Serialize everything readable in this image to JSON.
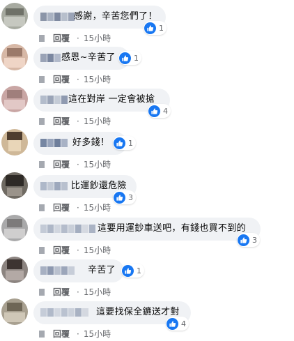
{
  "actions": {
    "reply": "回覆",
    "dot": "·",
    "time": "15小時"
  },
  "comments": [
    {
      "text": "感謝，辛苦您們了！",
      "likes": "1"
    },
    {
      "text": "感恩~辛苦了",
      "likes": "1"
    },
    {
      "text": "這在對岸 一定會被搶",
      "likes": "4"
    },
    {
      "text": "好多錢！",
      "likes": "1"
    },
    {
      "text": "比運鈔還危險",
      "likes": "3"
    },
    {
      "text": "這要用運鈔車送吧，有錢也買不到的",
      "likes": "3"
    },
    {
      "text": "辛苦了",
      "likes": "1"
    },
    {
      "text": "這要找保全鑣送才對",
      "likes": "4"
    }
  ],
  "colors": {
    "like": "#1877f2",
    "bubble": "#f0f2f5",
    "meta": "#65676b"
  },
  "icons": {
    "like": "thumbs-up-icon"
  }
}
